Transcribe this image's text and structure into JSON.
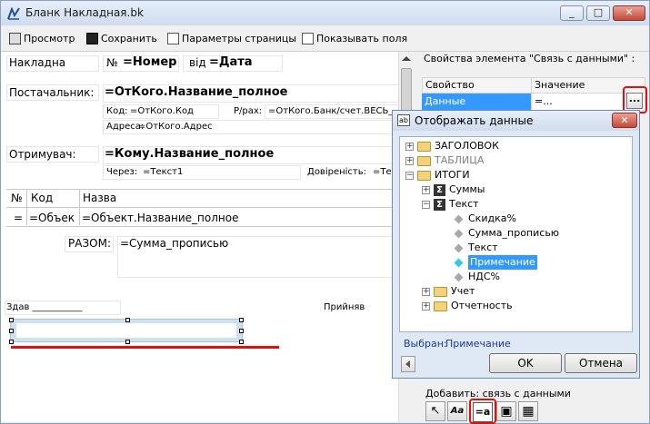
{
  "window": {
    "title": "Бланк  Накладная.bk",
    "min": "_",
    "max": "□",
    "close": "✕"
  },
  "toolbar": {
    "preview": "Просмотр",
    "save": "Сохранить",
    "page_params": "Параметры страницы",
    "show_fields": "Показывать поля"
  },
  "form": {
    "nakladna": "Накладна",
    "no_label": "№",
    "number": "=Номер",
    "vid": "від",
    "date": "=Дата",
    "supplier_label": "Постачальник:",
    "supplier_name": "=ОтКого.Название_полное",
    "code_label": "Код:",
    "code_value": "=ОтКого.Код",
    "account_label": "Р/рах:",
    "account_value": "=ОтКого.Банк/счет.ВЕСЬ_",
    "address_label": "Адреса:",
    "address_value": "=ОтКого.Адрес",
    "receiver_label": "Отримувач:",
    "receiver_name": "=Кому.Название_полное",
    "through_label": "Через:",
    "through_value": "=Текст1",
    "trust_label": "Довіреність:",
    "trust_value": "=Тек",
    "col_no": "№",
    "col_code": "Код",
    "col_name": "Назва",
    "row_no": "=",
    "row_code": "=Объек",
    "row_name": "=Объект.Название_полное",
    "total_label": "РАЗОМ:",
    "total_value": "=Сумма_прописью",
    "gave": "Здав ___________",
    "received": "Прийняв"
  },
  "props": {
    "title": "Свойства элемента \"Связь с данными\" :",
    "col_prop": "Свойство",
    "col_value": "Значение",
    "row_prop": "Данные",
    "row_value": "=...",
    "ellipsis": "...",
    "add_label": "Добавить: связь с данными"
  },
  "dialog": {
    "title": "Отображать данные",
    "close": "✕",
    "tree": [
      {
        "label": "ЗАГОЛОВОК"
      },
      {
        "label": "ТАБЛИЦА"
      },
      {
        "label": "ИТОГИ"
      },
      {
        "label": "Суммы"
      },
      {
        "label": "Текст"
      },
      {
        "label": "Скидка%"
      },
      {
        "label": "Сумма_прописью"
      },
      {
        "label": "Текст"
      },
      {
        "label": "Примечание"
      },
      {
        "label": "НДС%"
      },
      {
        "label": "Учет"
      },
      {
        "label": "Отчетность"
      }
    ],
    "selected_label": "Выбран:",
    "selected_value": "Примечание",
    "ok": "OK",
    "cancel": "Отмена"
  },
  "tools": {
    "pointer": "↖",
    "text_style": "Aa",
    "data_link": "=a",
    "image": "▣",
    "table": "▦"
  },
  "colors": {
    "highlight_red": "#e01010",
    "selection_blue": "#3399ff",
    "link_blue": "#1a3a9c"
  }
}
